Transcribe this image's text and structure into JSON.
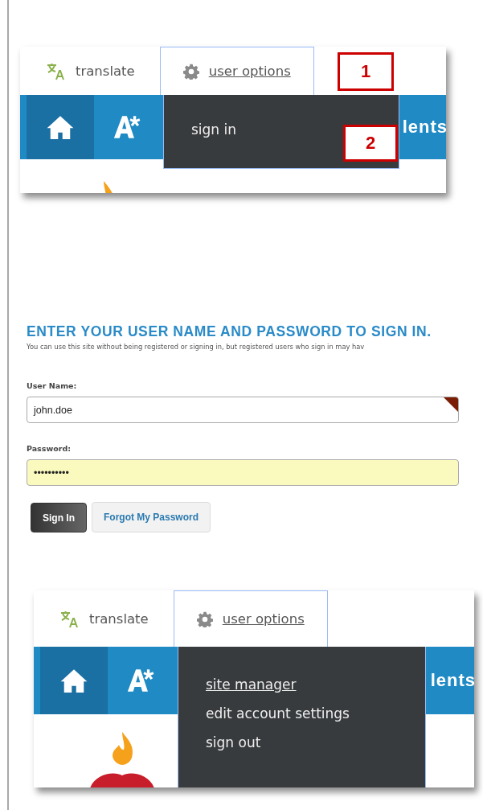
{
  "screenshot_1": {
    "tabs": [
      {
        "label": "translate",
        "selected": false
      },
      {
        "label": "user options",
        "selected": true
      }
    ],
    "nav_text": "lents",
    "menu_items": [
      {
        "label": "sign in",
        "hovered": false
      }
    ],
    "callouts": [
      "1",
      "2"
    ]
  },
  "sign_in_form": {
    "heading": "ENTER YOUR USER NAME AND PASSWORD TO SIGN IN.",
    "description": "You can use this site without being registered or signing in, but registered users who sign in may hav",
    "fields": [
      {
        "label": "User Name:",
        "value": "john.doe",
        "autofilled": false
      },
      {
        "label": "Password:",
        "value": "••••••••••",
        "autofilled": true
      }
    ],
    "buttons": [
      {
        "label": "Sign In",
        "primary": true
      },
      {
        "label": "Forgot My Password",
        "primary": false
      }
    ]
  },
  "screenshot_2": {
    "tabs": [
      {
        "label": "translate",
        "selected": false
      },
      {
        "label": "user options",
        "selected": true
      }
    ],
    "nav_text": "lents",
    "menu_items": [
      {
        "label": "site manager",
        "hovered": true
      },
      {
        "label": "edit account settings",
        "hovered": false
      },
      {
        "label": "sign out",
        "hovered": false
      }
    ]
  }
}
